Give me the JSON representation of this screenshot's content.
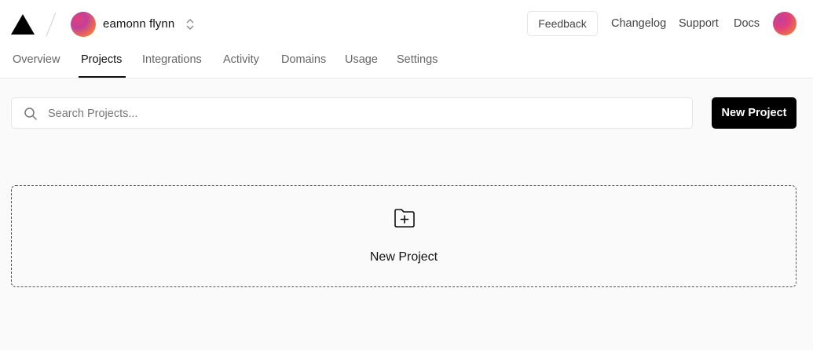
{
  "header": {
    "logo_icon": "triangle-logo-icon",
    "team": {
      "name": "eamonn flynn",
      "switch_icon": "chevron-up-down-icon"
    },
    "links": {
      "feedback": "Feedback",
      "changelog": "Changelog",
      "support": "Support",
      "docs": "Docs"
    },
    "user_avatar_icon": "user-avatar"
  },
  "tabs": [
    {
      "label": "Overview",
      "active": false
    },
    {
      "label": "Projects",
      "active": true
    },
    {
      "label": "Integrations",
      "active": false
    },
    {
      "label": "Activity",
      "active": false
    },
    {
      "label": "Domains",
      "active": false
    },
    {
      "label": "Usage",
      "active": false
    },
    {
      "label": "Settings",
      "active": false
    }
  ],
  "search": {
    "placeholder": "Search Projects...",
    "value": "",
    "icon": "search-icon"
  },
  "actions": {
    "new_project": "New Project"
  },
  "empty_state": {
    "label": "New Project",
    "icon": "folder-plus-icon"
  },
  "colors": {
    "background": "#fafafa",
    "primary_button": "#000000",
    "avatar_gradient": [
      "#c2409a",
      "#e0407d",
      "#ea6f4a",
      "#f39c3a"
    ]
  }
}
